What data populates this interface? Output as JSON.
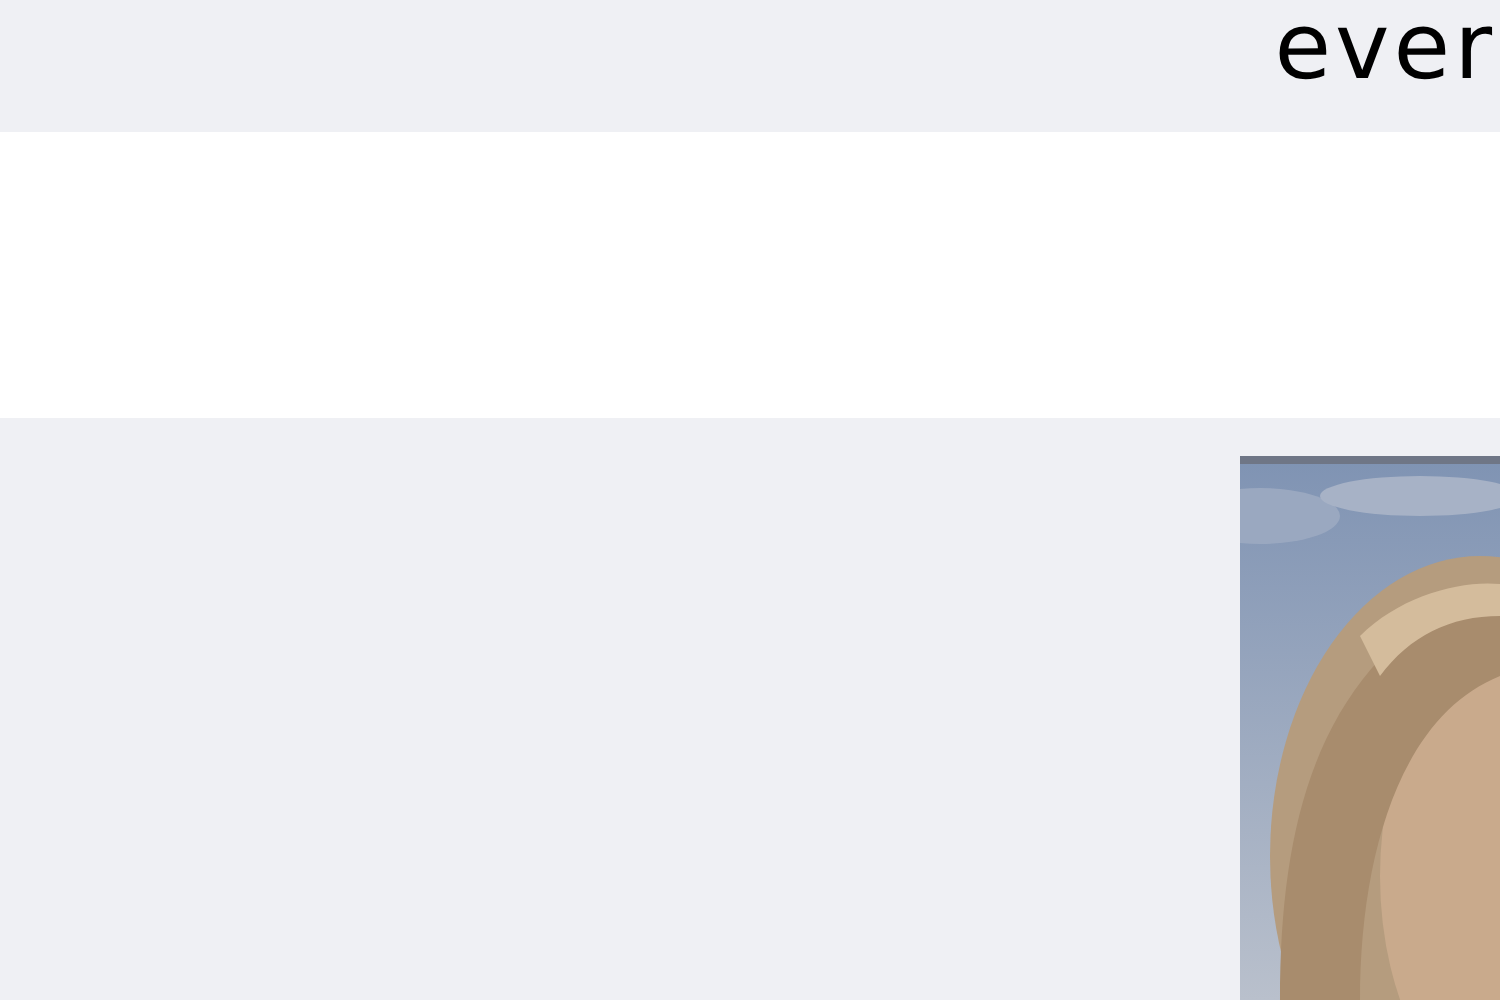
{
  "heading": {
    "text": "ever"
  }
}
